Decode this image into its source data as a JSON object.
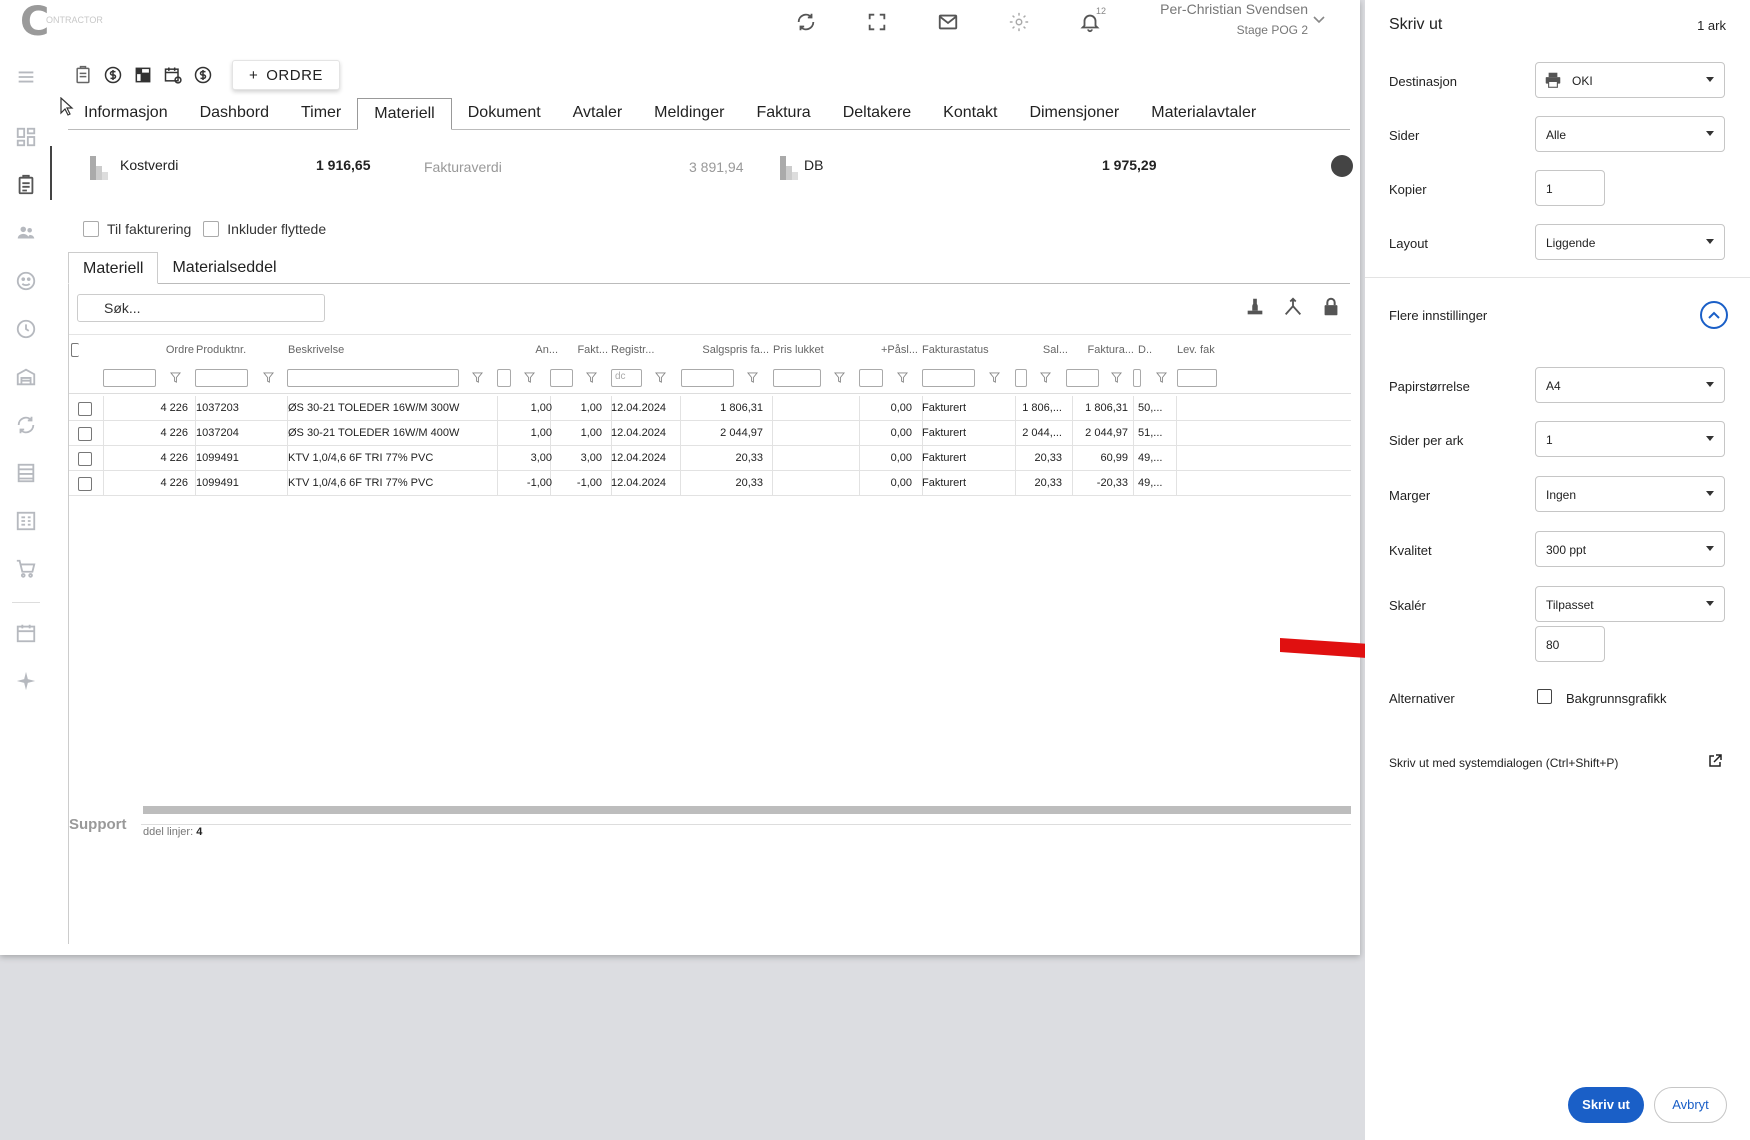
{
  "app": {
    "logo_text": "ONTRACTOR",
    "user_name": "Per-Christian Svendsen",
    "user_sub": "Stage POG 2",
    "notification_count": "12",
    "ordre_button": "ORDRE",
    "tabs": [
      "Informasjon",
      "Dashbord",
      "Timer",
      "Materiell",
      "Dokument",
      "Avtaler",
      "Meldinger",
      "Faktura",
      "Deltakere",
      "Kontakt",
      "Dimensjoner",
      "Materialavtaler"
    ],
    "active_tab": "Materiell",
    "summary": {
      "kostverdi_label": "Kostverdi",
      "kostverdi_value": "1 916,65",
      "fakturaverdi_label": "Fakturaverdi",
      "fakturaverdi_value": "3 891,94",
      "db_label": "DB",
      "db_value": "1 975,29"
    },
    "filters": {
      "til_fakturering": "Til fakturering",
      "inkluder_flyttede": "Inkluder flyttede"
    },
    "subtabs": [
      "Materiell",
      "Materialseddel"
    ],
    "search_placeholder": "Søk...",
    "columns": [
      "Ordre",
      "Produktnr.",
      "Beskrivelse",
      "An...",
      "Fakt...",
      "Registr...",
      "Salgspris fa...",
      "Pris lukket",
      "+Påsl...",
      "Fakturastatus",
      "Sal...",
      "Faktura...",
      "D..",
      "Lev. fak"
    ],
    "date_filter_value": "dc",
    "rows": [
      {
        "ordre": "4 226",
        "produktnr": "1037203",
        "beskrivelse": "ØS 30-21 TOLEDER 16W/M 300W",
        "an": "1,00",
        "fakt": "1,00",
        "registr": "12.04.2024",
        "salgspris": "1 806,31",
        "pasl": "0,00",
        "status": "Fakturert",
        "sal": "1 806,...",
        "faktura": "1 806,31",
        "d": "50,..."
      },
      {
        "ordre": "4 226",
        "produktnr": "1037204",
        "beskrivelse": "ØS 30-21 TOLEDER 16W/M 400W",
        "an": "1,00",
        "fakt": "1,00",
        "registr": "12.04.2024",
        "salgspris": "2 044,97",
        "pasl": "0,00",
        "status": "Fakturert",
        "sal": "2 044,...",
        "faktura": "2 044,97",
        "d": "51,..."
      },
      {
        "ordre": "4 226",
        "produktnr": "1099491",
        "beskrivelse": "KTV 1,0/4,6 6F TRI 77% PVC",
        "an": "3,00",
        "fakt": "3,00",
        "registr": "12.04.2024",
        "salgspris": "20,33",
        "pasl": "0,00",
        "status": "Fakturert",
        "sal": "20,33",
        "faktura": "60,99",
        "d": "49,..."
      },
      {
        "ordre": "4 226",
        "produktnr": "1099491",
        "beskrivelse": "KTV 1,0/4,6 6F TRI 77% PVC",
        "an": "-1,00",
        "fakt": "-1,00",
        "registr": "12.04.2024",
        "salgspris": "20,33",
        "pasl": "0,00",
        "status": "Fakturert",
        "sal": "20,33",
        "faktura": "-20,33",
        "d": "49,..."
      }
    ],
    "support_label": "Support",
    "linjer_label": "ddel linjer:",
    "linjer_count": "4"
  },
  "print": {
    "title": "Skriv ut",
    "sheet_count": "1 ark",
    "destinasjon_label": "Destinasjon",
    "destinasjon_value": "OKI",
    "sider_label": "Sider",
    "sider_value": "Alle",
    "kopier_label": "Kopier",
    "kopier_value": "1",
    "layout_label": "Layout",
    "layout_value": "Liggende",
    "more_settings_label": "Flere innstillinger",
    "papir_label": "Papirstørrelse",
    "papir_value": "A4",
    "sider_per_ark_label": "Sider per ark",
    "sider_per_ark_value": "1",
    "marger_label": "Marger",
    "marger_value": "Ingen",
    "kvalitet_label": "Kvalitet",
    "kvalitet_value": "300 ppt",
    "skaler_label": "Skalér",
    "skaler_value": "Tilpasset",
    "skaler_percent": "80",
    "alternativer_label": "Alternativer",
    "bakgrunn_label": "Bakgrunnsgrafikk",
    "system_dialog_label": "Skriv ut med systemdialogen (Ctrl+Shift+P)",
    "print_button": "Skriv ut",
    "cancel_button": "Avbryt"
  },
  "colors": {
    "accent": "#1a5fc7",
    "arrow": "#e01010",
    "backdrop": "#dcdde1"
  }
}
